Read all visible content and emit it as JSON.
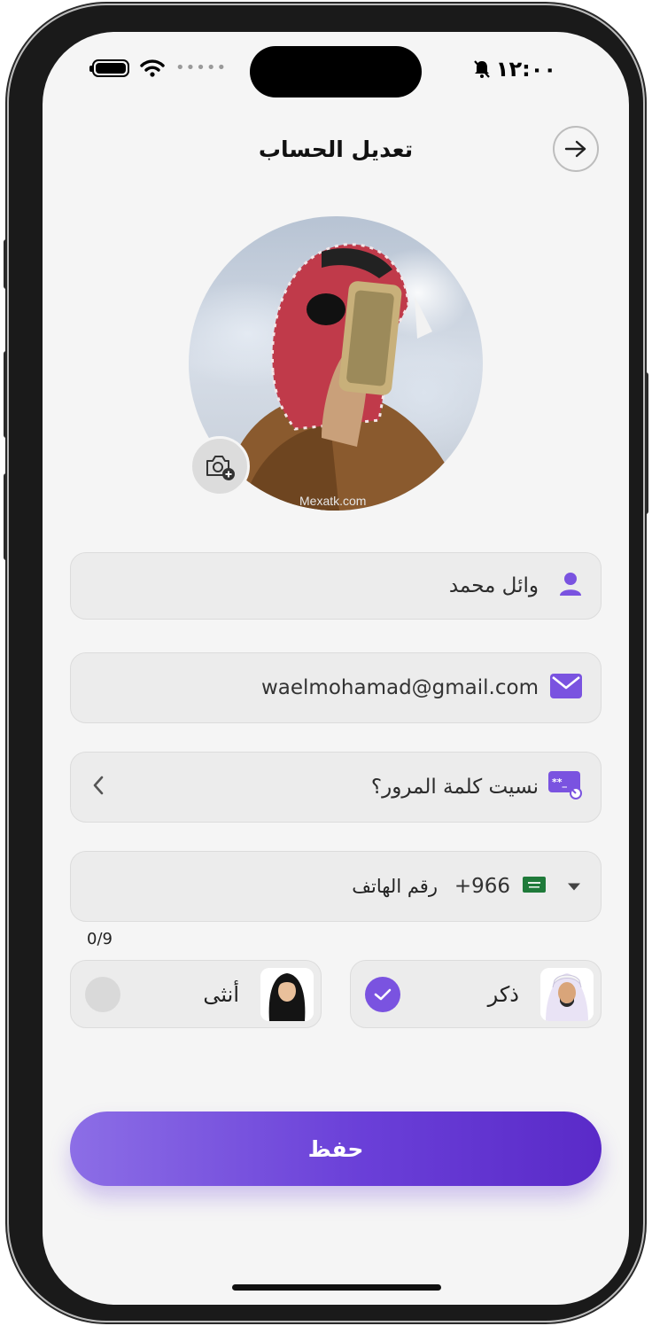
{
  "status_bar": {
    "time": "١٢:٠٠"
  },
  "header": {
    "title": "تعديل الحساب"
  },
  "profile": {
    "watermark": "Mexatk.com"
  },
  "form": {
    "name_value": "وائل محمد",
    "email_value": "waelmohamad@gmail.com",
    "forgot_password_label": "نسيت كلمة المرور؟",
    "phone_code": "+966",
    "phone_placeholder": "رقم الهاتف",
    "phone_counter": "0/9"
  },
  "gender": {
    "male_label": "ذكر",
    "female_label": "أنثى",
    "selected": "male"
  },
  "actions": {
    "save_label": "حفظ"
  },
  "colors": {
    "accent": "#7a53e0",
    "accent_dark": "#5a2ac8",
    "field_bg": "#ececec"
  },
  "icons": [
    "back-arrow-icon",
    "camera-add-icon",
    "user-icon",
    "mail-icon",
    "password-icon",
    "chevron-left-icon",
    "dropdown-icon",
    "saudi-flag-icon",
    "check-icon"
  ]
}
